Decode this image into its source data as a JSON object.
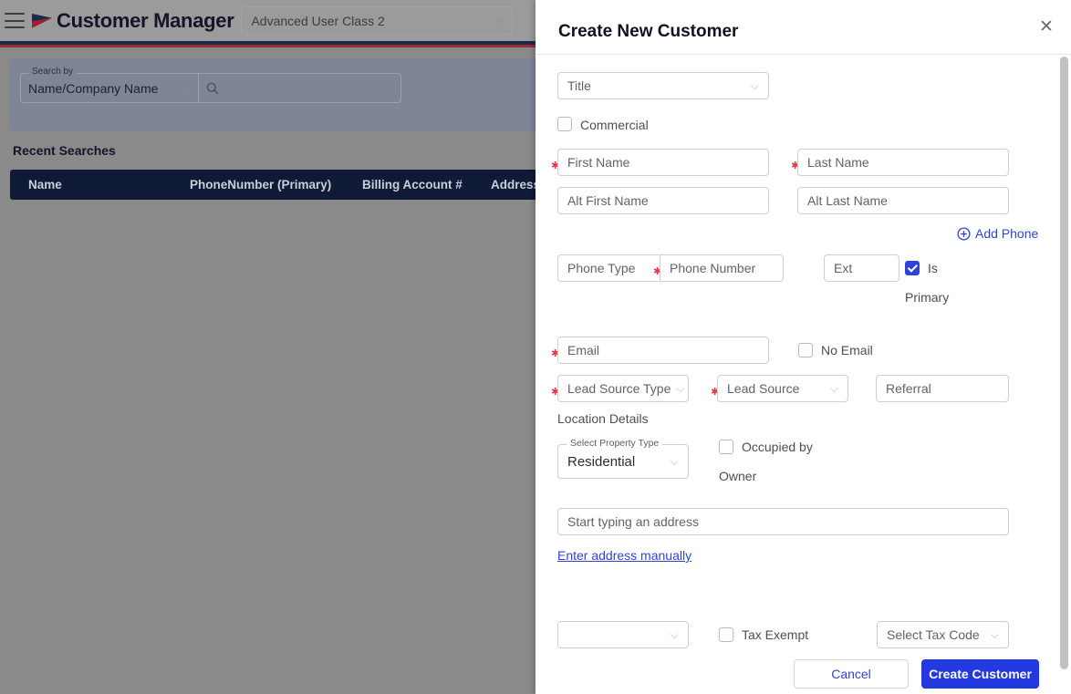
{
  "app": {
    "title": "Customer Manager",
    "menu_icon": "hamburger-icon",
    "logo_icon": "pennant-logo-icon",
    "user_class": "Advanced User Class 2",
    "search": {
      "legend": "Search by",
      "selected": "Name/Company Name",
      "input_value": "",
      "input_placeholder": "",
      "search_icon": "search-icon"
    },
    "recent_searches_label": "Recent Searches",
    "table_headers": [
      "Name",
      "PhoneNumber (Primary)",
      "Billing Account #",
      "Address"
    ]
  },
  "modal": {
    "title": "Create New Customer",
    "close_icon": "close-icon",
    "fields": {
      "title_select": "Title",
      "commercial_label": "Commercial",
      "first_name": "First Name",
      "last_name": "Last Name",
      "alt_first_name": "Alt First Name",
      "alt_last_name": "Alt Last Name",
      "add_phone": "Add Phone",
      "add_phone_icon": "plus-circle-icon",
      "phone_type": "Phone Type",
      "phone_number": "Phone Number",
      "ext": "Ext",
      "is_primary_line1": "Is",
      "is_primary_line2": "Primary",
      "email": "Email",
      "no_email_label": "No Email",
      "lead_source_type": "Lead Source Type",
      "lead_source": "Lead Source",
      "referral": "Referral",
      "location_details": "Location Details",
      "property_type_legend": "Select Property Type",
      "property_type_value": "Residential",
      "occupied_by_line1": "Occupied by",
      "occupied_by_line2": "Owner",
      "address_placeholder": "Start typing an address",
      "enter_address_manually": "Enter address manually",
      "bottom_select": "",
      "tax_exempt_label": "Tax Exempt",
      "tax_code": "Select Tax Code"
    },
    "buttons": {
      "cancel": "Cancel",
      "create": "Create Customer"
    },
    "checkbox_states": {
      "commercial": false,
      "is_primary": true,
      "no_email": false,
      "occupied_by_owner": false,
      "tax_exempt": false
    }
  },
  "colors": {
    "primary_button": "#2238e0",
    "link": "#2f43d8",
    "required_star": "#e03b46",
    "header_navy": "#1b2b4d",
    "header_red": "#9c2a33",
    "table_header_bg": "#0f1a36",
    "backdrop": "#8a8a8a"
  }
}
